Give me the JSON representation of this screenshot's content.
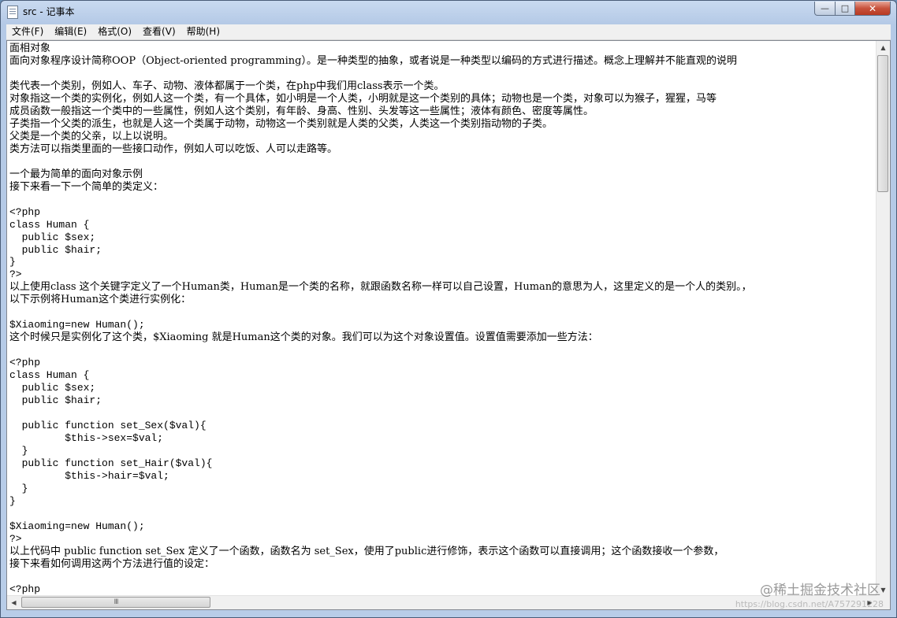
{
  "window": {
    "title": "src - 记事本",
    "controls": {
      "minimize": "—",
      "maximize": "□",
      "close": "✕"
    }
  },
  "menu": [
    "文件(F)",
    "编辑(E)",
    "格式(O)",
    "查看(V)",
    "帮助(H)"
  ],
  "lines": [
    {
      "text": "面相对象",
      "code": false
    },
    {
      "text": "面向对象程序设计简称OOP（Object-oriented programming）。是一种类型的抽象，或者说是一种类型以编码的方式进行描述。概念上理解并不能直观的说明",
      "code": false
    },
    {
      "text": "",
      "code": false
    },
    {
      "text": "类代表一个类别，例如人、车子、动物、液体都属于一个类，在php中我们用class表示一个类。",
      "code": false
    },
    {
      "text": "对象指这一个类的实例化，例如人这一个类，有一个具体，如小明是一个人类，小明就是这一个类别的具体；动物也是一个类，对象可以为猴子，猩猩，马等",
      "code": false
    },
    {
      "text": "成员函数一般指这一个类中的一些属性，例如人这个类别，有年龄、身高、性别、头发等这一些属性；液体有颜色、密度等属性。",
      "code": false
    },
    {
      "text": "子类指一个父类的派生，也就是人这一个类属于动物，动物这一个类别就是人类的父类，人类这一个类别指动物的子类。",
      "code": false
    },
    {
      "text": "父类是一个类的父亲，以上以说明。",
      "code": false
    },
    {
      "text": "类方法可以指类里面的一些接口动作，例如人可以吃饭、人可以走路等。",
      "code": false
    },
    {
      "text": "",
      "code": false
    },
    {
      "text": "一个最为简单的面向对象示例",
      "code": false
    },
    {
      "text": "接下来看一下一个简单的类定义：",
      "code": false
    },
    {
      "text": "",
      "code": false
    },
    {
      "text": "<?php",
      "code": true
    },
    {
      "text": "class Human {",
      "code": true
    },
    {
      "text": "  public $sex;",
      "code": true
    },
    {
      "text": "  public $hair;",
      "code": true
    },
    {
      "text": "}",
      "code": true
    },
    {
      "text": "?>",
      "code": true
    },
    {
      "text": "以上使用class 这个关键字定义了一个Human类，Human是一个类的名称，就跟函数名称一样可以自己设置，Human的意思为人，这里定义的是一个人的类别。，",
      "code": false
    },
    {
      "text": "以下示例将Human这个类进行实例化：",
      "code": false
    },
    {
      "text": "",
      "code": false
    },
    {
      "text": "$Xiaoming=new Human();",
      "code": true
    },
    {
      "text": "这个时候只是实例化了这个类，$Xiaoming 就是Human这个类的对象。我们可以为这个对象设置值。设置值需要添加一些方法：",
      "code": false
    },
    {
      "text": "",
      "code": false
    },
    {
      "text": "<?php",
      "code": true
    },
    {
      "text": "class Human {",
      "code": true
    },
    {
      "text": "  public $sex;",
      "code": true
    },
    {
      "text": "  public $hair;",
      "code": true
    },
    {
      "text": "",
      "code": true
    },
    {
      "text": "  public function set_Sex($val){",
      "code": true
    },
    {
      "text": "         $this->sex=$val;",
      "code": true
    },
    {
      "text": "  }",
      "code": true
    },
    {
      "text": "  public function set_Hair($val){",
      "code": true
    },
    {
      "text": "         $this->hair=$val;",
      "code": true
    },
    {
      "text": "  }",
      "code": true
    },
    {
      "text": "}",
      "code": true
    },
    {
      "text": "",
      "code": true
    },
    {
      "text": "$Xiaoming=new Human();",
      "code": true
    },
    {
      "text": "?>",
      "code": true
    },
    {
      "text": "以上代码中 public function set_Sex 定义了一个函数，函数名为 set_Sex，使用了public进行修饰，表示这个函数可以直接调用；这个函数接收一个参数，",
      "code": false
    },
    {
      "text": "接下来看如何调用这两个方法进行值的设定：",
      "code": false
    },
    {
      "text": "",
      "code": false
    },
    {
      "text": "<?php",
      "code": true
    }
  ],
  "scrollbar": {
    "h_thumb_grip": "III"
  },
  "watermark": {
    "label": "@稀土掘金技术社区",
    "url": "https://blog.csdn.net/A757291228"
  }
}
